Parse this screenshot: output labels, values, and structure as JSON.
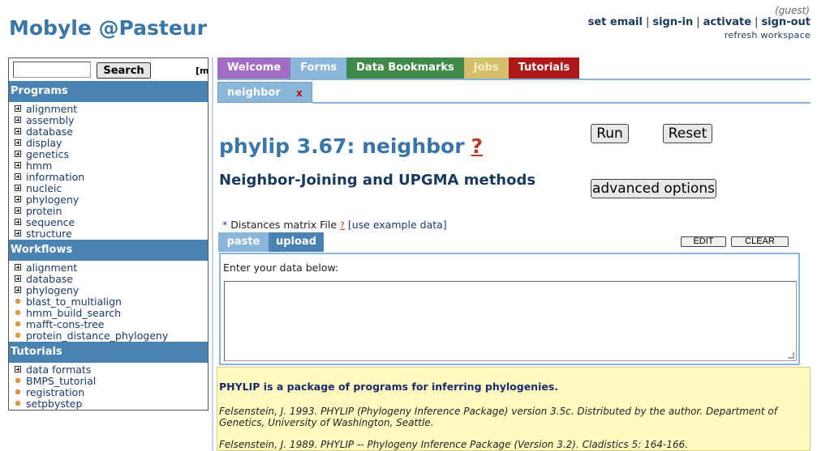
{
  "header": {
    "brand": "Mobyle @Pasteur",
    "guest": "(guest)",
    "links": [
      "set email",
      "sign-in",
      "activate",
      "sign-out"
    ],
    "refresh": "refresh workspace"
  },
  "search": {
    "value": "",
    "button": "Search",
    "extra": "[m"
  },
  "sidebar": {
    "programs": {
      "title": "Programs",
      "items": [
        "alignment",
        "assembly",
        "database",
        "display",
        "genetics",
        "hmm",
        "information",
        "nucleic",
        "phylogeny",
        "protein",
        "sequence",
        "structure"
      ]
    },
    "workflows": {
      "title": "Workflows",
      "folders": [
        "alignment",
        "database",
        "phylogeny"
      ],
      "items": [
        "blast_to_multialign",
        "hmm_build_search",
        "mafft-cons-tree",
        "protein_distance_phylogeny"
      ]
    },
    "tutorials": {
      "title": "Tutorials",
      "folders": [
        "data formats"
      ],
      "items": [
        "BMPS_tutorial",
        "registration",
        "setpbystep"
      ]
    }
  },
  "tabs": [
    {
      "label": "Welcome",
      "color": "#a06cc4"
    },
    {
      "label": "Forms",
      "color": "#8ab6dc"
    },
    {
      "label": "Data Bookmarks",
      "color": "#3f8a48"
    },
    {
      "label": "Jobs",
      "color": "#d4c06a"
    },
    {
      "label": "Tutorials",
      "color": "#b01818"
    }
  ],
  "subtab": {
    "label": "neighbor",
    "close": "x"
  },
  "form": {
    "title": "phylip 3.67: neighbor",
    "help": "?",
    "subtitle": "Neighbor-Joining and UPGMA methods",
    "run": "Run",
    "reset": "Reset",
    "advanced": "advanced options",
    "param": {
      "star": "*",
      "label": "Distances matrix File",
      "help": "?",
      "example": "[use example data]"
    },
    "input_tabs": [
      "paste",
      "upload"
    ],
    "edit": "EDIT",
    "clear": "CLEAR",
    "enter_label": "Enter your data below:"
  },
  "info": {
    "head": "PHYLIP is a package of programs for inferring phylogenies.",
    "refs": [
      "Felsenstein, J. 1993. PHYLIP (Phylogeny Inference Package) version 3.5c. Distributed by the author. Department of Genetics, University of Washington, Seattle.",
      "Felsenstein, J. 1989. PHYLIP -- Phylogeny Inference Package (Version 3.2). Cladistics 5: 164-166."
    ]
  }
}
